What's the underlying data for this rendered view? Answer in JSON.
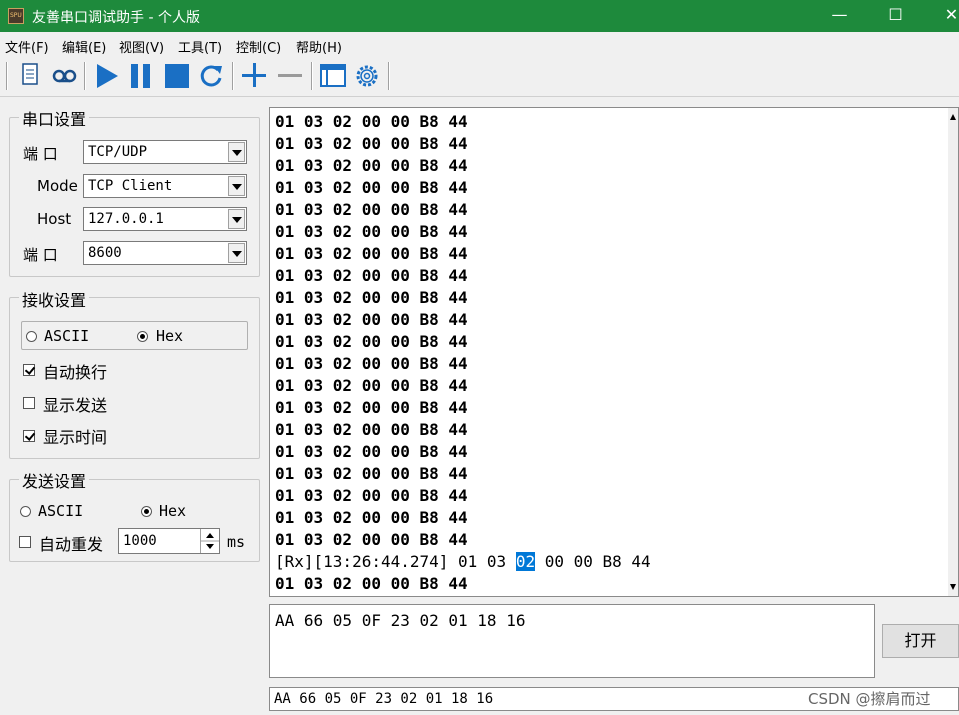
{
  "window": {
    "title": "友善串口调试助手 - 个人版",
    "app_icon_text": "SPU",
    "minimize": "—",
    "maximize": "☐",
    "close": "✕"
  },
  "menu": [
    "文件(F)",
    "编辑(E)",
    "视图(V)",
    "工具(T)",
    "控制(C)",
    "帮助(H)"
  ],
  "toolbar": {
    "icons": [
      "document-icon",
      "record-icon",
      "play-icon",
      "pause-icon",
      "stop-icon",
      "refresh-icon",
      "plus-icon",
      "minus-icon",
      "window-icon",
      "gear-icon"
    ],
    "accent": "#1a6fc4"
  },
  "serial_settings": {
    "title": "串口设置",
    "port_label": "端  口",
    "port_value": "TCP/UDP",
    "mode_label": "Mode",
    "mode_value": "TCP Client",
    "host_label": "Host",
    "host_value": "127.0.0.1",
    "port2_label": "端  口",
    "port2_value": "8600"
  },
  "receive_settings": {
    "title": "接收设置",
    "ascii_label": "ASCII",
    "hex_label": "Hex",
    "selected": "Hex",
    "auto_wrap_label": "自动换行",
    "auto_wrap": true,
    "show_send_label": "显示发送",
    "show_send": false,
    "show_time_label": "显示时间",
    "show_time": true
  },
  "send_settings": {
    "title": "发送设置",
    "ascii_label": "ASCII",
    "hex_label": "Hex",
    "selected": "Hex",
    "auto_resend_label": "自动重发",
    "auto_resend": false,
    "interval_value": "1000",
    "interval_unit": "ms"
  },
  "receive_area": {
    "lines": [
      "01 03 02 00 00 B8 44",
      "01 03 02 00 00 B8 44",
      "01 03 02 00 00 B8 44",
      "01 03 02 00 00 B8 44",
      "01 03 02 00 00 B8 44",
      "01 03 02 00 00 B8 44",
      "01 03 02 00 00 B8 44",
      "01 03 02 00 00 B8 44",
      "01 03 02 00 00 B8 44",
      "01 03 02 00 00 B8 44",
      "01 03 02 00 00 B8 44",
      "01 03 02 00 00 B8 44",
      "01 03 02 00 00 B8 44",
      "01 03 02 00 00 B8 44",
      "01 03 02 00 00 B8 44",
      "01 03 02 00 00 B8 44",
      "01 03 02 00 00 B8 44",
      "01 03 02 00 00 B8 44",
      "01 03 02 00 00 B8 44",
      "01 03 02 00 00 B8 44"
    ],
    "rx_line_prefix": "[Rx][13:26:44.274] 01 03 ",
    "rx_line_highlight": "02",
    "rx_line_suffix": " 00 00 B8 44",
    "last_line": "01 03 02 00 00 B8 44"
  },
  "send_area": {
    "text": "AA 66 05 0F 23 02 01 18 16",
    "open_button": "打开"
  },
  "history": {
    "value": "AA 66 05 0F 23 02 01 18 16"
  },
  "watermark": "CSDN @擦肩而过"
}
